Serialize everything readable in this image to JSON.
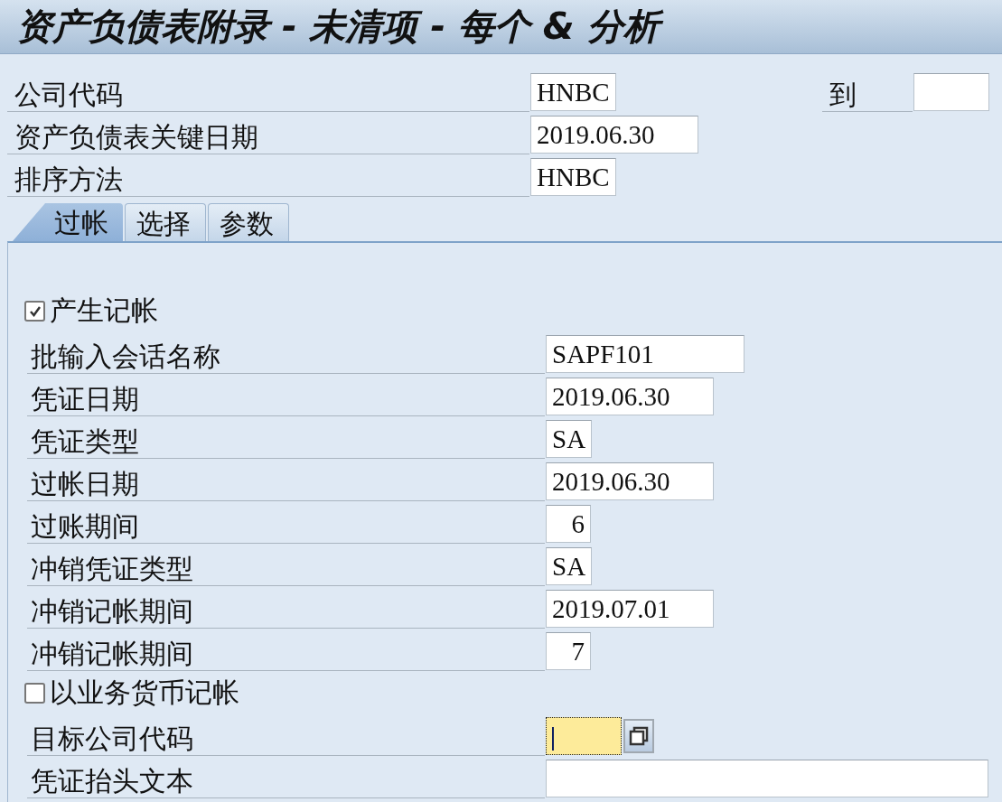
{
  "title": "资产负债表附录 - 未清项 - 每个 & 分析",
  "header_fields": [
    {
      "label": "公司代码",
      "value": "HNBC",
      "to_label": "到"
    },
    {
      "label": "资产负债表关键日期",
      "value": "2019.06.30"
    },
    {
      "label": "排序方法",
      "value": "HNBC"
    }
  ],
  "tabs": [
    {
      "label": "过帐",
      "selected": true
    },
    {
      "label": "选择",
      "selected": false
    },
    {
      "label": "参数",
      "selected": false
    }
  ],
  "panel": {
    "rows": [
      {
        "kind": "checkbox",
        "label": "产生记帐",
        "checked": true
      },
      {
        "kind": "field",
        "label": "批输入会话名称",
        "value": "SAPF101"
      },
      {
        "kind": "field",
        "label": "凭证日期",
        "value": "2019.06.30"
      },
      {
        "kind": "field",
        "label": "凭证类型",
        "value": "SA"
      },
      {
        "kind": "field",
        "label": "过帐日期",
        "value": "2019.06.30"
      },
      {
        "kind": "number",
        "label": "过账期间",
        "value": "6"
      },
      {
        "kind": "field",
        "label": "冲销凭证类型",
        "value": "SA"
      },
      {
        "kind": "field",
        "label": "冲销记帐期间",
        "value": "2019.07.01"
      },
      {
        "kind": "number",
        "label": "冲销记帐期间",
        "value": "7"
      },
      {
        "kind": "checkbox",
        "label": "以业务货币记帐",
        "checked": false
      },
      {
        "kind": "field",
        "label": "目标公司代码",
        "focused": true,
        "value_help": true
      },
      {
        "kind": "field",
        "label": "凭证抬头文本"
      }
    ]
  }
}
